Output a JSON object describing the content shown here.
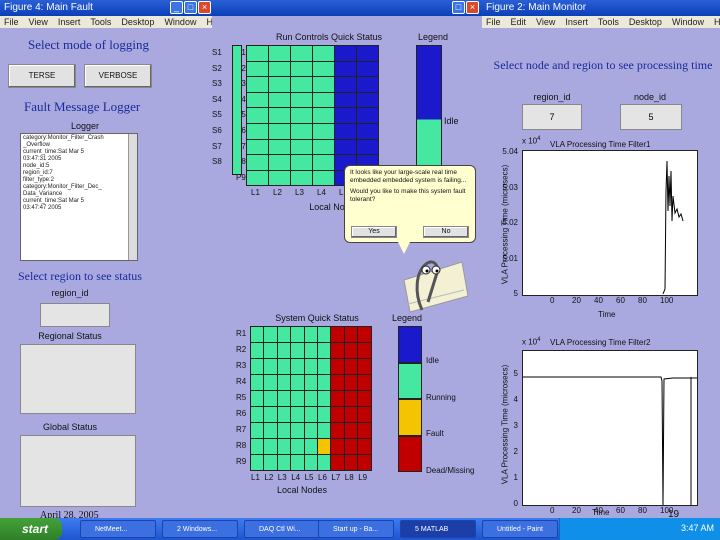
{
  "left_window": {
    "title": "Figure 4: Main Fault",
    "menu": [
      "File",
      "View",
      "Insert",
      "Tools",
      "Desktop",
      "Window",
      "Help"
    ],
    "mode_heading": "Select mode of logging",
    "terse_label": "TERSE",
    "verbose_label": "VERBOSE",
    "logger_heading": "Fault Message Logger",
    "logger_label": "Logger",
    "log_lines": [
      "category:Monitor_Filter_Crash",
      "_Overflow",
      "current_time:Sat Mar 5",
      "03:47:31 2005",
      "",
      "node_id:5",
      "region_id:7",
      "filter_type:2",
      "category:Monitor_Filter_Dec_",
      "Data_Variance",
      "current_time:Sat Mar 5",
      "03:47:47 2005"
    ],
    "region_heading": "Select region to see status",
    "region_id_label": "region_id",
    "regional_status_label": "Regional Status",
    "global_status_label": "Global Status",
    "date_text": "April 28, 2005"
  },
  "middle": {
    "top_title": "Run Controls Quick Status",
    "top_legend_title": "Legend",
    "top_idle_label": "Idle",
    "top_row_labels_left": [
      "S1",
      "S2",
      "S3",
      "S4",
      "S5",
      "S6",
      "S7",
      "S8"
    ],
    "top_row_labels": [
      "P1",
      "P2",
      "P3",
      "P4",
      "P5",
      "P6",
      "P7",
      "P8",
      "P9"
    ],
    "top_col_labels": [
      "L1",
      "L2",
      "L3",
      "L4",
      "L5",
      "L6"
    ],
    "top_xlabel": "Local Node",
    "bottom_title": "System Quick Status",
    "bottom_legend_title": "Legend",
    "legend_items": [
      {
        "label": "Idle",
        "color": "#1a1acc"
      },
      {
        "label": "Running",
        "color": "#44e8a0"
      },
      {
        "label": "Fault",
        "color": "#f5c400"
      },
      {
        "label": "Dead/Missing",
        "color": "#c00000"
      }
    ],
    "bottom_row_labels": [
      "R1",
      "R2",
      "R3",
      "R4",
      "R5",
      "R6",
      "R7",
      "R8",
      "R9"
    ],
    "bottom_col_labels": [
      "L1",
      "L2",
      "L3",
      "L4",
      "L5",
      "L6",
      "L7",
      "L8",
      "L9"
    ],
    "bottom_xlabel": "Local Nodes",
    "fault_cell": {
      "row": 7,
      "col": 5
    }
  },
  "clippy": {
    "message": "It looks like your large-scale real time embedded embedded system is failing...",
    "question": "Would you like to make this system fault tolerant?",
    "yes_label": "Yes",
    "no_label": "No"
  },
  "right_window": {
    "title": "Figure 2: Main Monitor",
    "menu": [
      "File",
      "Edit",
      "View",
      "Insert",
      "Tools",
      "Desktop",
      "Window",
      "Help"
    ],
    "heading": "Select node and region to see processing time",
    "region_id_label": "region_id",
    "node_id_label": "node_id",
    "region_id_value": "7",
    "node_id_value": "5",
    "plot1": {
      "title": "VLA Processing Time Filter1",
      "exponent": "x 10",
      "exp_power": "4",
      "ylabel": "VLA Processing Time (microsecs)",
      "xlabel": "Time",
      "yticks": [
        "5.04",
        "5.03",
        "5.02",
        "5.01",
        "5"
      ],
      "xticks": [
        "0",
        "20",
        "40",
        "60",
        "80",
        "100"
      ]
    },
    "plot2": {
      "title": "VLA Processing Time Filter2",
      "exponent": "x 10",
      "exp_power": "4",
      "ylabel": "VLA Processing Time (microsecs)",
      "xlabel": "Time",
      "yticks": [
        "5",
        "4",
        "3",
        "2",
        "1",
        "0"
      ],
      "xticks": [
        "0",
        "20",
        "40",
        "60",
        "80",
        "100"
      ]
    }
  },
  "slide_number": "19",
  "taskbar": {
    "start_label": "start",
    "tasks": [
      "NetMeet...",
      "2 Windows...",
      "DAQ Ctl Wi...",
      "Start up - Ba...",
      "5 MATLAB",
      "Untitled - Paint"
    ],
    "clock": "3:47 AM"
  }
}
